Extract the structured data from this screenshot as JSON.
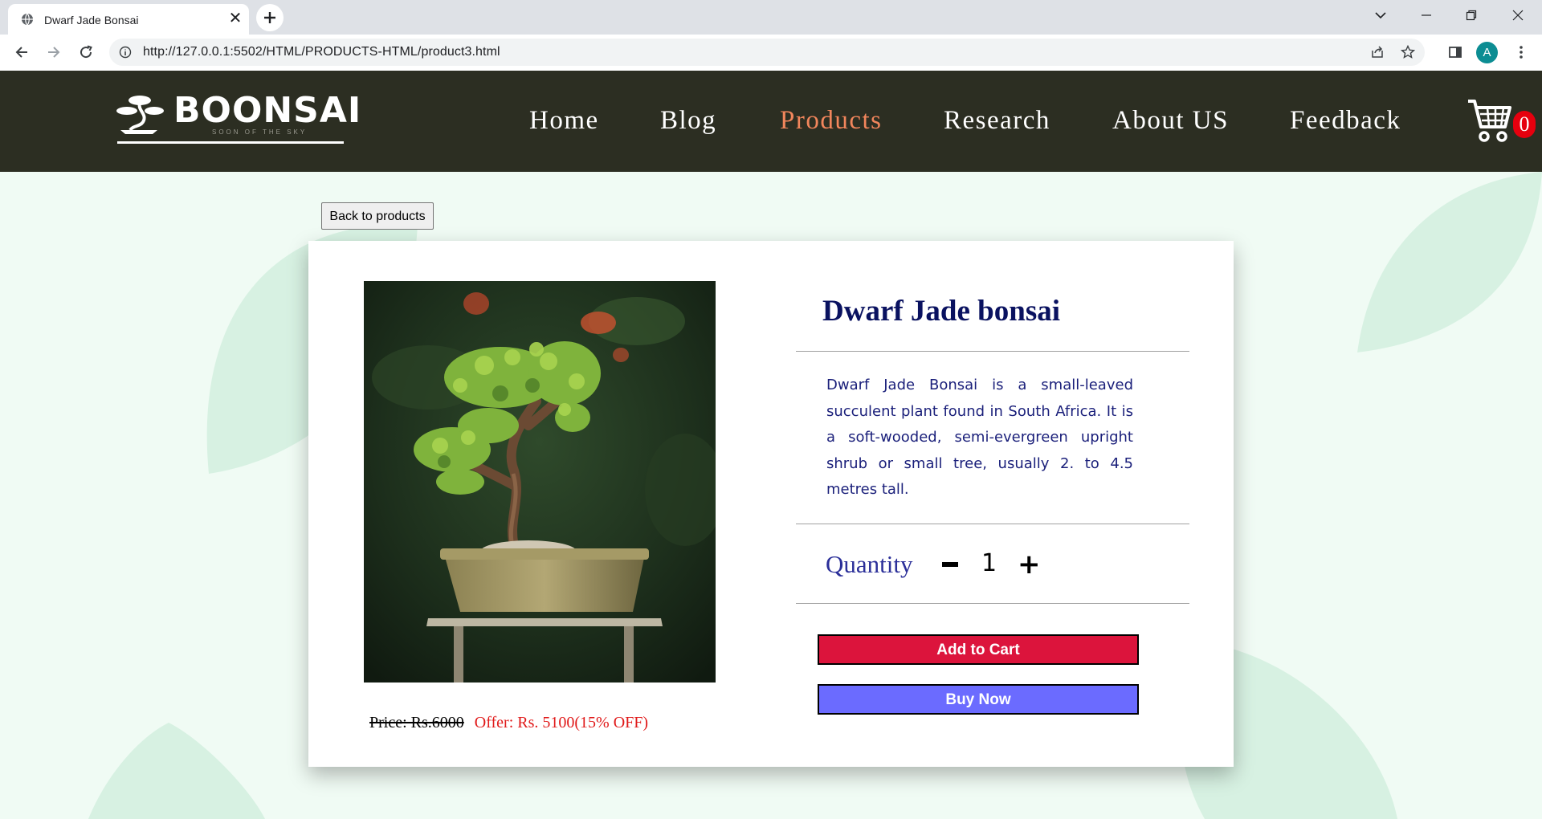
{
  "browser": {
    "tab_title": "Dwarf Jade Bonsai",
    "tab_close": "✕",
    "new_tab": "+",
    "url": "http://127.0.0.1:5502/HTML/PRODUCTS-HTML/product3.html",
    "profile_initial": "A"
  },
  "site": {
    "logo_text": "BOONSAI",
    "logo_tagline": "SOON OF THE SKY",
    "nav": [
      {
        "label": "Home"
      },
      {
        "label": "Blog"
      },
      {
        "label": "Products",
        "active": true
      },
      {
        "label": "Research"
      },
      {
        "label": "About US"
      },
      {
        "label": "Feedback"
      }
    ],
    "cart_count": "0",
    "accent_active": "#f2865c",
    "header_bg": "#2c2e22"
  },
  "page": {
    "back_label": "Back to products",
    "product": {
      "title": "Dwarf Jade bonsai",
      "description": "Dwarf Jade Bonsai is a small-leaved succulent plant found in South Africa. It is a soft-wooded, semi-evergreen upright shrub or small tree, usually 2. to 4.5 metres tall.",
      "price_label": "Price: Rs.6000",
      "offer_label": "Offer: Rs. 5100(15% OFF)",
      "quantity_label": "Quantity",
      "quantity_minus": "−",
      "quantity_value": "1",
      "quantity_plus": "+",
      "add_to_cart_label": "Add to Cart",
      "buy_now_label": "Buy Now"
    },
    "colors": {
      "add_to_cart": "#dc143c",
      "buy_now": "#6b6bff",
      "offer": "#e01919",
      "title": "#0a1260"
    }
  }
}
